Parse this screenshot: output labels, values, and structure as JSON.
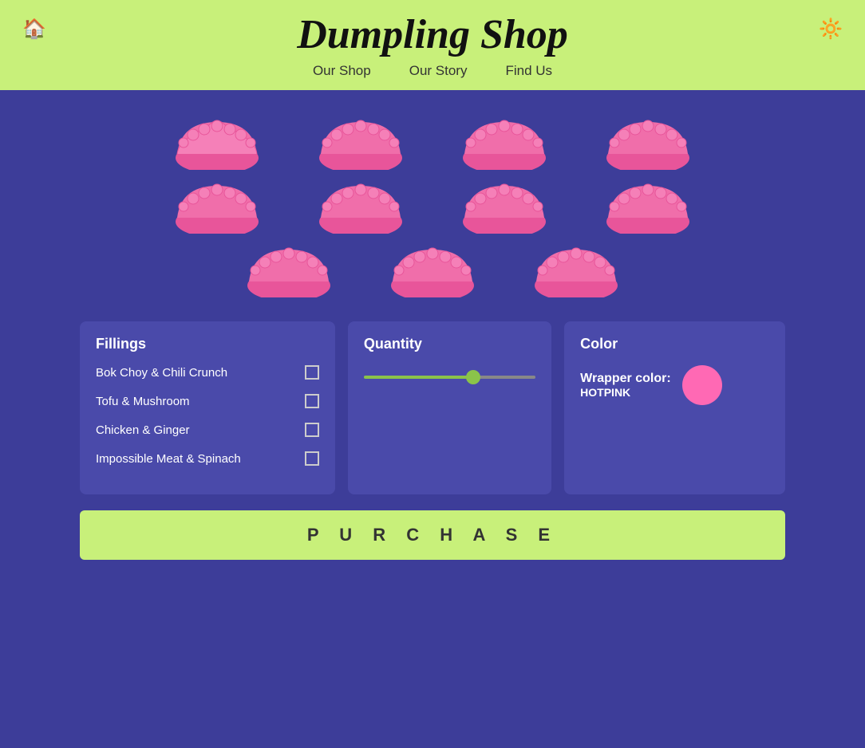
{
  "header": {
    "title": "Dumpling Shop",
    "home_icon": "🏠",
    "settings_icon": "🔆",
    "nav": [
      {
        "label": "Our Shop"
      },
      {
        "label": "Our Story"
      },
      {
        "label": "Find Us"
      }
    ]
  },
  "dumplings": {
    "rows": [
      {
        "count": 4
      },
      {
        "count": 4
      },
      {
        "count": 3
      }
    ]
  },
  "fillings": {
    "title": "Fillings",
    "items": [
      {
        "label": "Bok Choy & Chili Crunch",
        "checked": false
      },
      {
        "label": "Tofu & Mushroom",
        "checked": false
      },
      {
        "label": "Chicken & Ginger",
        "checked": false
      },
      {
        "label": "Impossible Meat & Spinach",
        "checked": false
      }
    ]
  },
  "quantity": {
    "title": "Quantity",
    "value": 65
  },
  "color": {
    "title": "Color",
    "label": "Wrapper color:",
    "color_name": "HOTPINK",
    "color_hex": "#FF69B4"
  },
  "purchase": {
    "label": "P U R C H A S E"
  }
}
